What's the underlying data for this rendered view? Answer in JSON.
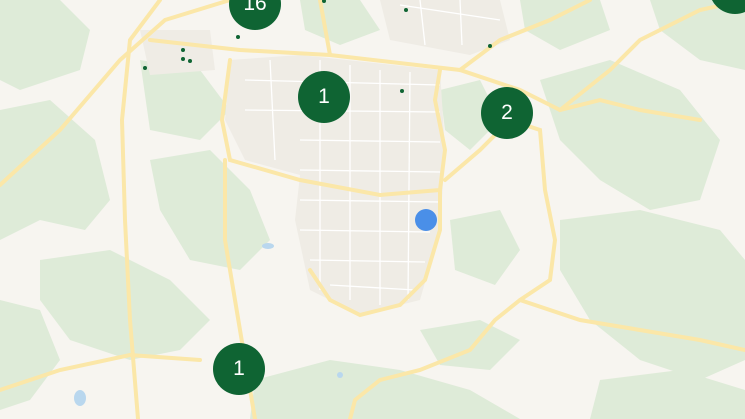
{
  "map": {
    "colors": {
      "land": "#f7f5f0",
      "forest": "#deebd8",
      "road_major": "#fbe7a8",
      "road_minor": "#f0ede6",
      "water": "#b9d7ee",
      "marker": "#0f6433",
      "user_location": "#4a8fe8"
    },
    "clusters": [
      {
        "id": "c16",
        "count": "16"
      },
      {
        "id": "c1a",
        "count": "1"
      },
      {
        "id": "c2",
        "count": "2"
      },
      {
        "id": "c1b",
        "count": "1"
      },
      {
        "id": "cEdge",
        "count": ""
      }
    ],
    "user_location_icon": "blue-dot"
  }
}
